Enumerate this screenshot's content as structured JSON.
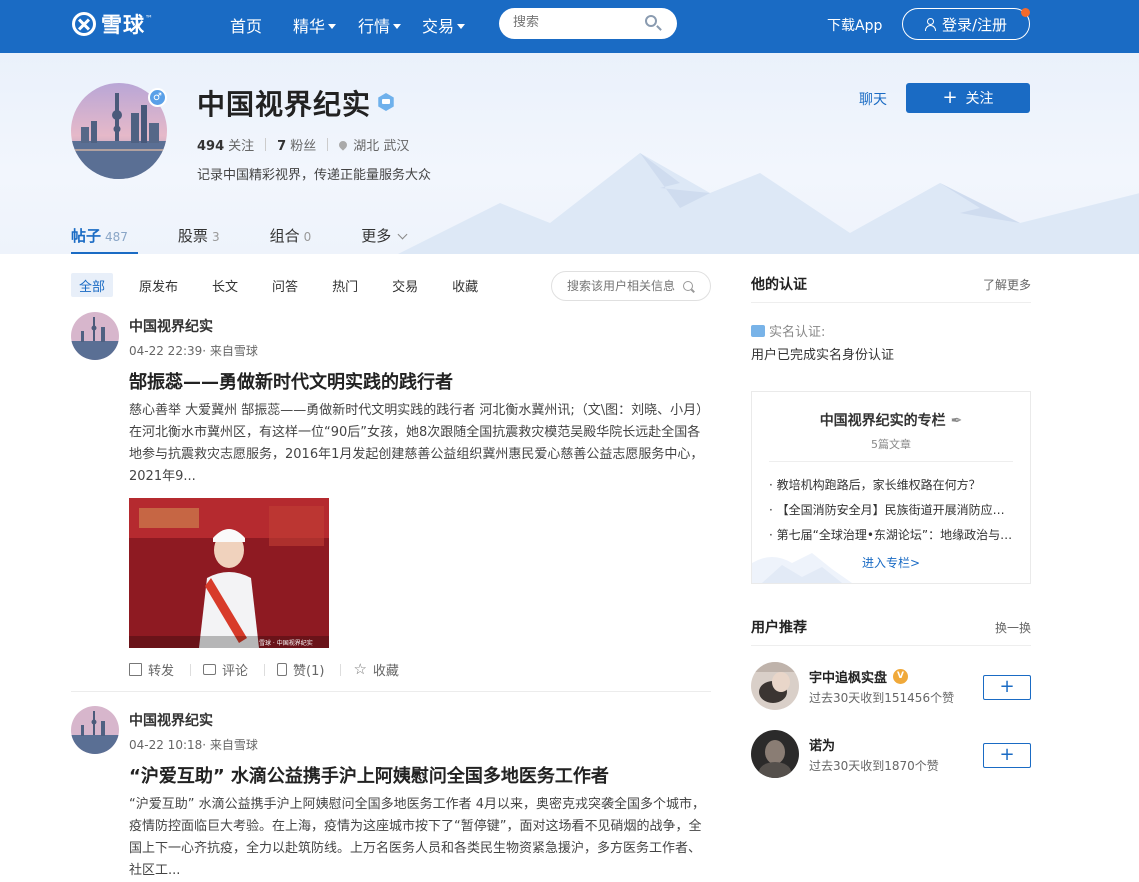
{
  "nav": {
    "logo_text": "雪球",
    "logo_tm": "™",
    "items": [
      {
        "label": "首页",
        "dropdown": false
      },
      {
        "label": "精华",
        "dropdown": true
      },
      {
        "label": "行情",
        "dropdown": true
      },
      {
        "label": "交易",
        "dropdown": true
      }
    ],
    "search_placeholder": "搜索",
    "download_label": "下载App",
    "login_label": "登录/注册",
    "brand_color": "#1a6bc4"
  },
  "profile": {
    "name": "中国视界纪实",
    "following_count": "494",
    "following_label": "关注",
    "followers_count": "7",
    "followers_label": "粉丝",
    "location": "湖北 武汉",
    "bio": "记录中国精彩视界，传递正能量服务大众",
    "gender_symbol": "♂",
    "chat_label": "聊天",
    "follow_label": "关注",
    "tabs": [
      {
        "label": "帖子",
        "count": "487",
        "active": true
      },
      {
        "label": "股票",
        "count": "3",
        "active": false
      },
      {
        "label": "组合",
        "count": "0",
        "active": false
      },
      {
        "label": "更多",
        "count": "",
        "active": false
      }
    ]
  },
  "filters": {
    "items": [
      "全部",
      "原发布",
      "长文",
      "问答",
      "热门",
      "交易",
      "收藏"
    ],
    "search_placeholder": "搜索该用户相关信息"
  },
  "posts": [
    {
      "author": "中国视界纪实",
      "meta": "04-22 22:39· 来自雪球",
      "title": "郜振蕊——勇做新时代文明实践的践行者",
      "body": "慈心善举 大爱冀州 郜振蕊——勇做新时代文明实践的践行者 河北衡水冀州讯;（文\\图：刘晓、小月）在河北衡水市冀州区，有这样一位“90后”女孩，她8次跟随全国抗震救灾模范吴殿华院长远赴全国各地参与抗震救灾志愿服务，2016年1月发起创建慈善公益组织冀州惠民爱心慈善公益志愿服务中心，2021年9...",
      "image_caption": "雪球 · 中国视界纪实",
      "actions": {
        "share": "转发",
        "comment": "评论",
        "like": "赞(1)",
        "favorite": "收藏"
      }
    },
    {
      "author": "中国视界纪实",
      "meta": "04-22 10:18· 来自雪球",
      "title": "“沪爱互助” 水滴公益携手沪上阿姨慰问全国多地医务工作者",
      "body": "“沪爱互助” 水滴公益携手沪上阿姨慰问全国多地医务工作者 4月以来，奥密克戎突袭全国多个城市，疫情防控面临巨大考验。在上海，疫情为这座城市按下了“暂停键”，面对这场看不见硝烟的战争，全国上下一心齐抗疫，全力以赴筑防线。上万名医务人员和各类民生物资紧急援沪，多方医务工作者、社区工..."
    }
  ],
  "sidebar": {
    "cert_title": "他的认证",
    "cert_more": "了解更多",
    "cert_label": "实名认证:",
    "cert_text": "用户已完成实名身份认证",
    "column_title": "中国视界纪实的专栏",
    "column_count": "5篇文章",
    "column_items": [
      "· 教培机构跑路后，家长维权路在何方？",
      "· 【全国消防安全月】民族街道开展消防应急演练",
      "· 第七届“全球治理•东湖论坛”：地缘政治与全球治理"
    ],
    "column_link": "进入专栏>",
    "rec_title": "用户推荐",
    "rec_more": "换一换",
    "recommendations": [
      {
        "name": "宇中追枫实盘",
        "verified": true,
        "badge": "V",
        "desc": "过去30天收到151456个赞",
        "button": "+"
      },
      {
        "name": "诺为",
        "verified": false,
        "badge": "",
        "desc": "过去30天收到1870个赞",
        "button": "+"
      }
    ]
  }
}
